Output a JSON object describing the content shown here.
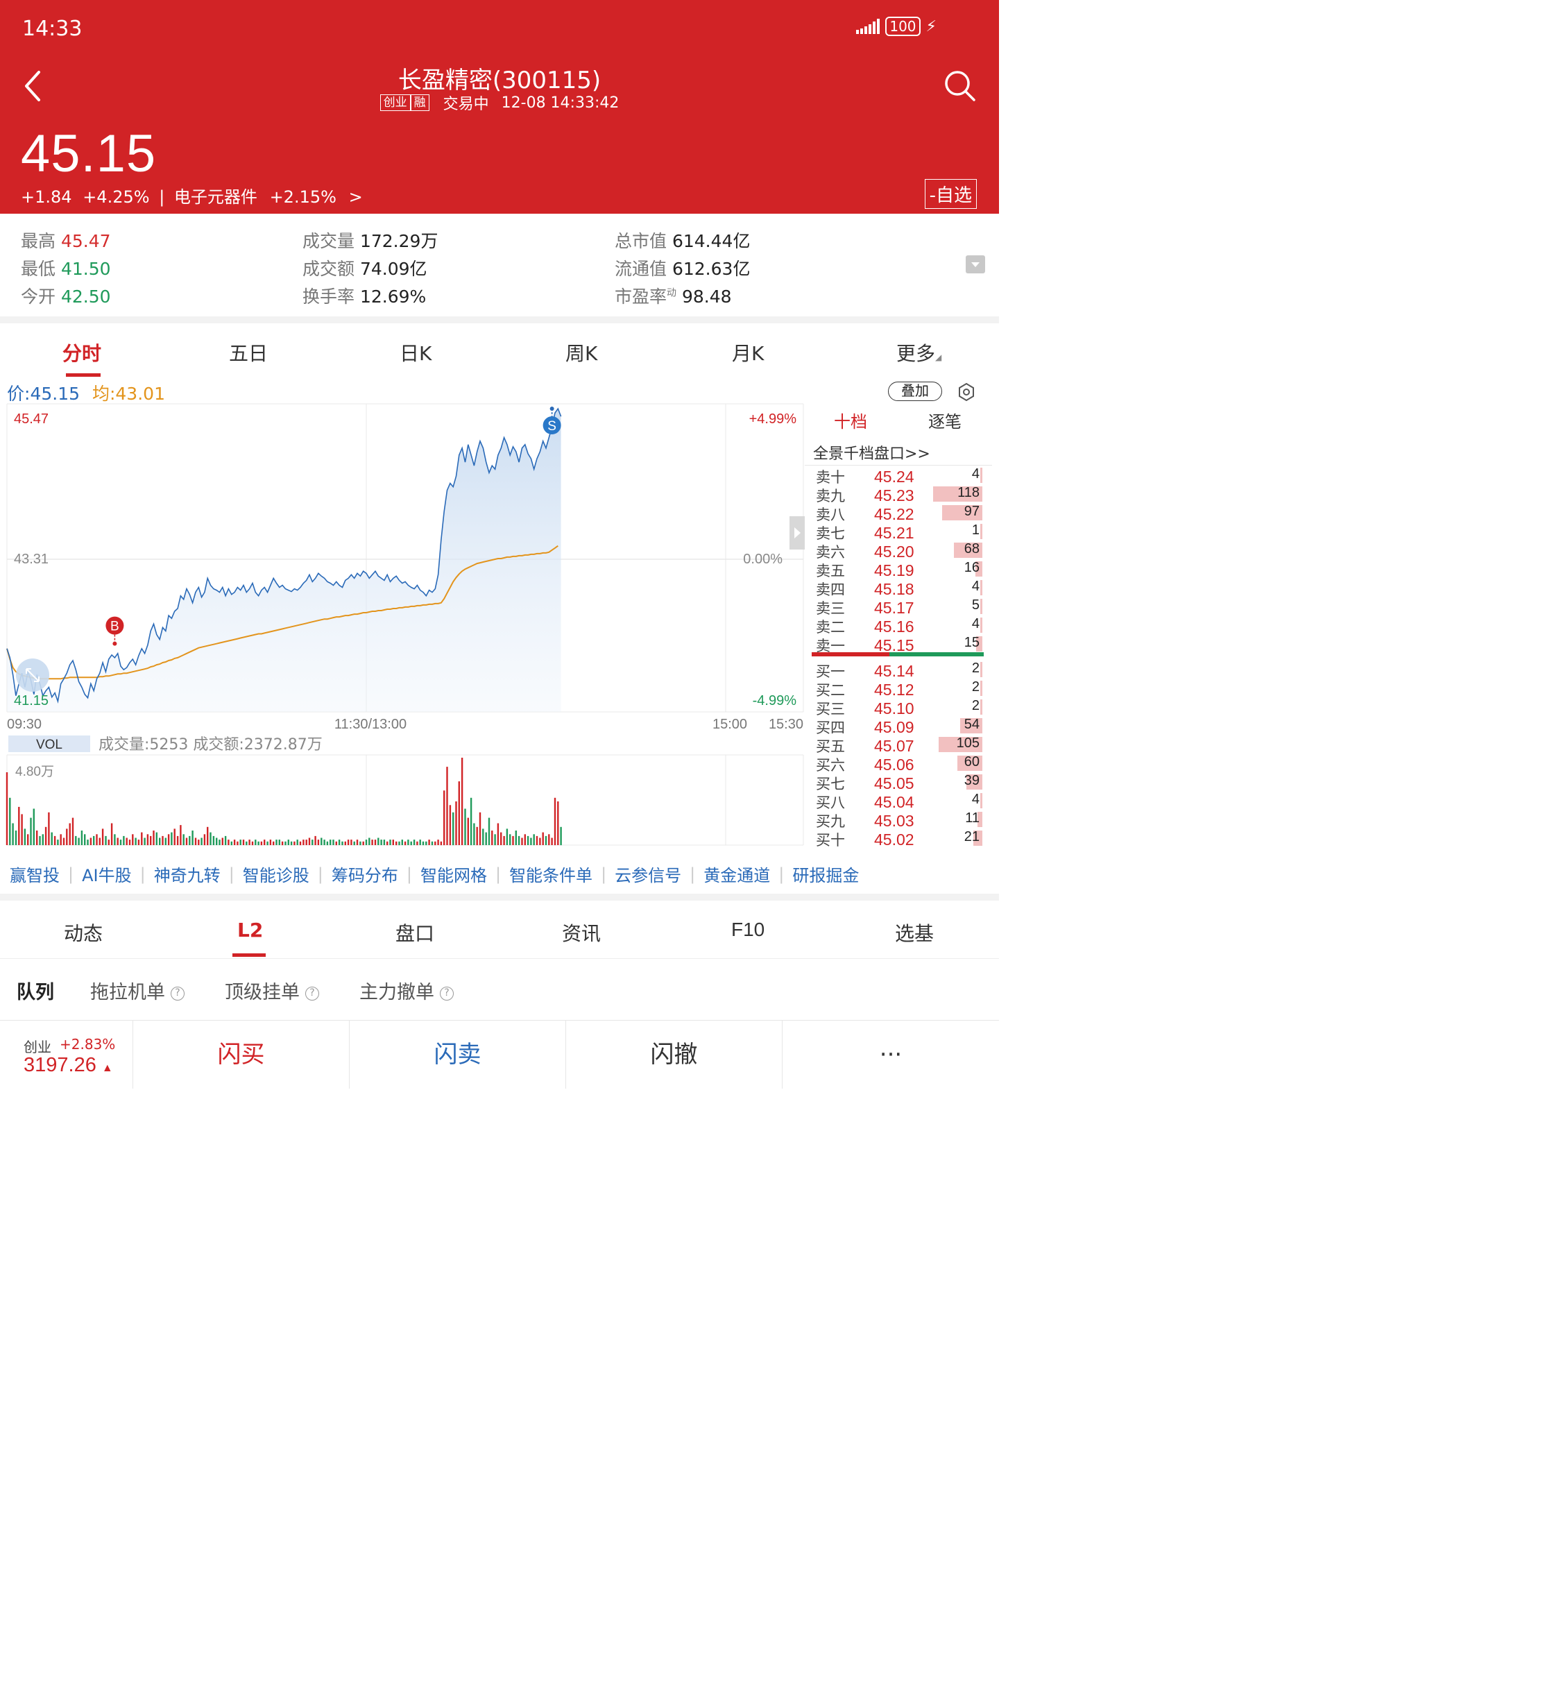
{
  "status_bar": {
    "time": "14:33",
    "battery": "100"
  },
  "header": {
    "title": "长盈精密(300115)",
    "tags": [
      "创业",
      "融"
    ],
    "trading_status": "交易中",
    "datetime": "12-08 14:33:42",
    "price": "45.15",
    "change": "+1.84",
    "change_pct": "+4.25%",
    "sector_separator": "|",
    "sector": "电子元器件",
    "sector_change": "+2.15%",
    "sector_arrow": ">",
    "watch_button": "-自选",
    "colors": {
      "header_bg": "#d12326",
      "up": "#d12326",
      "down": "#1f9a5a"
    }
  },
  "stats": {
    "high": {
      "label": "最高",
      "value": "45.47"
    },
    "low": {
      "label": "最低",
      "value": "41.50"
    },
    "open": {
      "label": "今开",
      "value": "42.50"
    },
    "volume": {
      "label": "成交量",
      "value": "172.29万"
    },
    "turnover": {
      "label": "成交额",
      "value": "74.09亿"
    },
    "turnover_rate": {
      "label": "换手率",
      "value": "12.69%"
    },
    "market_cap": {
      "label": "总市值",
      "value": "614.44亿"
    },
    "float_cap": {
      "label": "流通值",
      "value": "612.63亿"
    },
    "pe": {
      "label": "市盈率",
      "sup": "动",
      "value": "98.48"
    }
  },
  "chart_tabs": [
    "分时",
    "五日",
    "日K",
    "周K",
    "月K",
    "更多"
  ],
  "legend": {
    "price_label": "价:",
    "price": "45.15",
    "avg_label": "均:",
    "avg": "43.01"
  },
  "overlay_button": "叠加",
  "chart_data": {
    "type": "line",
    "y_labels": {
      "top": "45.47",
      "mid": "43.31",
      "bottom": "41.15"
    },
    "pct_labels": {
      "top": "+4.99%",
      "mid": "0.00%",
      "bottom": "-4.99%"
    },
    "x_labels": [
      "09:30",
      "11:30/13:00",
      "15:00",
      "15:30"
    ],
    "ylim": [
      41.15,
      45.47
    ],
    "markers": [
      {
        "label": "B",
        "price": 42.12,
        "index": 36
      },
      {
        "label": "S",
        "price": 45.46,
        "index": 182
      }
    ],
    "series": [
      {
        "name": "价",
        "color": "#2a6ab8",
        "values": [
          42.05,
          41.92,
          41.68,
          41.38,
          41.55,
          41.7,
          41.5,
          41.72,
          41.6,
          41.4,
          41.68,
          41.55,
          41.38,
          41.45,
          41.5,
          41.36,
          41.42,
          41.3,
          41.55,
          41.62,
          41.7,
          41.82,
          41.88,
          41.75,
          41.58,
          41.5,
          41.4,
          41.35,
          41.55,
          41.45,
          41.62,
          41.7,
          41.85,
          41.72,
          41.9,
          41.96,
          41.92,
          41.98,
          41.8,
          41.75,
          41.78,
          41.85,
          41.9,
          41.82,
          41.95,
          42.05,
          41.98,
          42.1,
          42.3,
          42.4,
          42.25,
          42.18,
          42.35,
          42.3,
          42.52,
          42.48,
          42.58,
          42.62,
          42.8,
          42.75,
          42.9,
          42.82,
          42.7,
          42.85,
          42.92,
          42.78,
          42.85,
          43.05,
          42.95,
          42.9,
          42.88,
          42.85,
          42.92,
          42.8,
          42.9,
          42.82,
          42.85,
          42.92,
          42.88,
          42.95,
          42.85,
          42.9,
          42.98,
          42.85,
          42.8,
          42.88,
          42.92,
          42.85,
          42.95,
          43.05,
          42.98,
          42.92,
          42.95,
          42.9,
          42.88,
          42.86,
          42.9,
          42.88,
          42.92,
          42.98,
          43.02,
          43.1,
          43.0,
          43.05,
          43.12,
          43.08,
          43.05,
          43.0,
          42.98,
          42.95,
          43.0,
          42.95,
          42.92,
          43.02,
          43.05,
          43.1,
          43.05,
          43.12,
          43.08,
          43.15,
          43.12,
          43.05,
          43.1,
          43.15,
          43.08,
          43.05,
          43.02,
          43.1,
          43.0,
          43.05,
          43.08,
          43.02,
          42.98,
          43.0,
          42.95,
          42.92,
          42.9,
          42.95,
          42.88,
          42.85,
          42.8,
          42.88,
          42.85,
          42.9,
          43.1,
          43.6,
          44.0,
          44.3,
          44.4,
          44.35,
          44.5,
          44.8,
          44.9,
          44.7,
          44.95,
          44.8,
          44.65,
          44.85,
          45.0,
          44.9,
          44.7,
          44.55,
          44.65,
          44.6,
          44.8,
          44.9,
          45.05,
          44.95,
          44.8,
          44.92,
          44.85,
          44.7,
          44.9,
          44.95,
          44.82,
          44.75,
          44.6,
          44.75,
          44.85,
          45.0,
          44.9,
          45.05,
          45.2,
          45.4,
          45.46,
          45.35
        ]
      },
      {
        "name": "均",
        "color": "#e3941c",
        "values": [
          42.05,
          41.9,
          41.78,
          41.72,
          41.69,
          41.67,
          41.66,
          41.65,
          41.64,
          41.63,
          41.63,
          41.62,
          41.62,
          41.62,
          41.62,
          41.62,
          41.62,
          41.62,
          41.62,
          41.63,
          41.63,
          41.64,
          41.64,
          41.64,
          41.64,
          41.64,
          41.64,
          41.64,
          41.64,
          41.64,
          41.64,
          41.65,
          41.65,
          41.66,
          41.66,
          41.67,
          41.68,
          41.69,
          41.69,
          41.7,
          41.7,
          41.71,
          41.72,
          41.73,
          41.74,
          41.75,
          41.76,
          41.77,
          41.79,
          41.8,
          41.82,
          41.83,
          41.85,
          41.86,
          41.88,
          41.89,
          41.91,
          41.92,
          41.94,
          41.96,
          41.98,
          42.0,
          42.02,
          42.04,
          42.06,
          42.07,
          42.08,
          42.09,
          42.1,
          42.11,
          42.12,
          42.13,
          42.14,
          42.15,
          42.16,
          42.17,
          42.18,
          42.19,
          42.2,
          42.21,
          42.22,
          42.23,
          42.24,
          42.25,
          42.26,
          42.26,
          42.27,
          42.28,
          42.29,
          42.3,
          42.31,
          42.32,
          42.33,
          42.34,
          42.35,
          42.36,
          42.37,
          42.38,
          42.39,
          42.4,
          42.41,
          42.42,
          42.43,
          42.44,
          42.45,
          42.46,
          42.47,
          42.47,
          42.48,
          42.49,
          42.5,
          42.5,
          42.51,
          42.52,
          42.52,
          42.53,
          42.54,
          42.54,
          42.55,
          42.56,
          42.56,
          42.57,
          42.58,
          42.58,
          42.59,
          42.59,
          42.6,
          42.61,
          42.61,
          42.62,
          42.62,
          42.63,
          42.63,
          42.64,
          42.64,
          42.65,
          42.65,
          42.66,
          42.66,
          42.67,
          42.67,
          42.68,
          42.68,
          42.69,
          42.69,
          42.7,
          42.76,
          42.84,
          42.92,
          43.0,
          43.06,
          43.11,
          43.15,
          43.18,
          43.2,
          43.22,
          43.24,
          43.26,
          43.27,
          43.28,
          43.29,
          43.3,
          43.31,
          43.32,
          43.33,
          43.33,
          43.34,
          43.35,
          43.35,
          43.36,
          43.36,
          43.37,
          43.37,
          43.38,
          43.38,
          43.39,
          43.39,
          43.4,
          43.4,
          43.41,
          43.41,
          43.42,
          43.45,
          43.48,
          43.51
        ]
      }
    ]
  },
  "volume_chart": {
    "label": "VOL",
    "info": "成交量:5253 成交额:2372.87万",
    "max_label": "4.80万",
    "max": 48000,
    "values": [
      40000,
      26000,
      12000,
      8000,
      21000,
      17000,
      9000,
      6000,
      15000,
      20000,
      8000,
      5000,
      6000,
      10000,
      18000,
      7000,
      5000,
      3000,
      6000,
      4000,
      9000,
      12000,
      15000,
      5000,
      4000,
      8000,
      6000,
      3000,
      4000,
      5000,
      6000,
      4000,
      9000,
      5000,
      3000,
      12000,
      6000,
      4000,
      3000,
      5000,
      4000,
      3000,
      6000,
      4000,
      3000,
      7000,
      4000,
      6000,
      5000,
      8000,
      7000,
      4000,
      5000,
      4000,
      6000,
      7000,
      9000,
      5000,
      11000,
      6000,
      4000,
      5000,
      8000,
      4000,
      3000,
      4000,
      6000,
      10000,
      7000,
      5000,
      4000,
      3000,
      4000,
      5000,
      3000,
      2000,
      3000,
      2000,
      3000,
      3000,
      2000,
      3000,
      2000,
      3000,
      2000,
      2000,
      3000,
      2000,
      3000,
      2000,
      3000,
      3000,
      2000,
      2000,
      3000,
      2000,
      2000,
      3000,
      2000,
      3000,
      3000,
      4000,
      3000,
      5000,
      3000,
      4000,
      3000,
      2000,
      3000,
      3000,
      2000,
      3000,
      2000,
      2000,
      3000,
      3000,
      2000,
      3000,
      2000,
      2000,
      3000,
      4000,
      3000,
      3000,
      4000,
      3000,
      3000,
      2000,
      3000,
      3000,
      2000,
      2000,
      3000,
      2000,
      3000,
      2000,
      3000,
      2000,
      3000,
      2000,
      2000,
      3000,
      2000,
      2000,
      3000,
      2000,
      30000,
      43000,
      22000,
      18000,
      24000,
      35000,
      48000,
      20000,
      15000,
      26000,
      12000,
      10000,
      18000,
      9000,
      7000,
      15000,
      8000,
      6000,
      12000,
      7000,
      5000,
      9000,
      6000,
      5000,
      8000,
      5000,
      4000,
      6000,
      5000,
      4000,
      6000,
      5000,
      4000,
      7000,
      5000,
      6000,
      4000,
      26000,
      24000,
      10000
    ]
  },
  "orderbook": {
    "tab_ten": "十档",
    "tab_tick": "逐笔",
    "link": "全景千档盘口>>",
    "asks": [
      {
        "name": "卖十",
        "price": "45.24",
        "qty": "4",
        "qty_num": 4
      },
      {
        "name": "卖九",
        "price": "45.23",
        "qty": "118",
        "qty_num": 118
      },
      {
        "name": "卖八",
        "price": "45.22",
        "qty": "97",
        "qty_num": 97
      },
      {
        "name": "卖七",
        "price": "45.21",
        "qty": "1",
        "qty_num": 1
      },
      {
        "name": "卖六",
        "price": "45.20",
        "qty": "68",
        "qty_num": 68
      },
      {
        "name": "卖五",
        "price": "45.19",
        "qty": "16",
        "qty_num": 16
      },
      {
        "name": "卖四",
        "price": "45.18",
        "qty": "4",
        "qty_num": 4
      },
      {
        "name": "卖三",
        "price": "45.17",
        "qty": "5",
        "qty_num": 5
      },
      {
        "name": "卖二",
        "price": "45.16",
        "qty": "4",
        "qty_num": 4
      },
      {
        "name": "卖一",
        "price": "45.15",
        "qty": "15",
        "qty_num": 15
      }
    ],
    "bids": [
      {
        "name": "买一",
        "price": "45.14",
        "qty": "2",
        "qty_num": 2
      },
      {
        "name": "买二",
        "price": "45.12",
        "qty": "2",
        "qty_num": 2
      },
      {
        "name": "买三",
        "price": "45.10",
        "qty": "2",
        "qty_num": 2
      },
      {
        "name": "买四",
        "price": "45.09",
        "qty": "54",
        "qty_num": 54
      },
      {
        "name": "买五",
        "price": "45.07",
        "qty": "105",
        "qty_num": 105
      },
      {
        "name": "买六",
        "price": "45.06",
        "qty": "60",
        "qty_num": 60
      },
      {
        "name": "买七",
        "price": "45.05",
        "qty": "39",
        "qty_num": 39
      },
      {
        "name": "买八",
        "price": "45.04",
        "qty": "4",
        "qty_num": 4
      },
      {
        "name": "买九",
        "price": "45.03",
        "qty": "11",
        "qty_num": 11
      },
      {
        "name": "买十",
        "price": "45.02",
        "qty": "21",
        "qty_num": 21
      }
    ]
  },
  "tool_links": [
    "赢智投",
    "AI牛股",
    "神奇九转",
    "智能诊股",
    "筹码分布",
    "智能网格",
    "智能条件单",
    "云参信号",
    "黄金通道",
    "研报掘金"
  ],
  "bottom_tabs": [
    "动态",
    "L2",
    "盘口",
    "资讯",
    "F10",
    "选基"
  ],
  "sub_tabs": [
    "队列",
    "拖拉机单",
    "顶级挂单",
    "主力撤单"
  ],
  "bottom_bar": {
    "index_name": "创业",
    "index_change": "+2.83%",
    "index_value": "3197.26",
    "buy": "闪买",
    "sell": "闪卖",
    "cancel": "闪撤",
    "more": "···"
  }
}
